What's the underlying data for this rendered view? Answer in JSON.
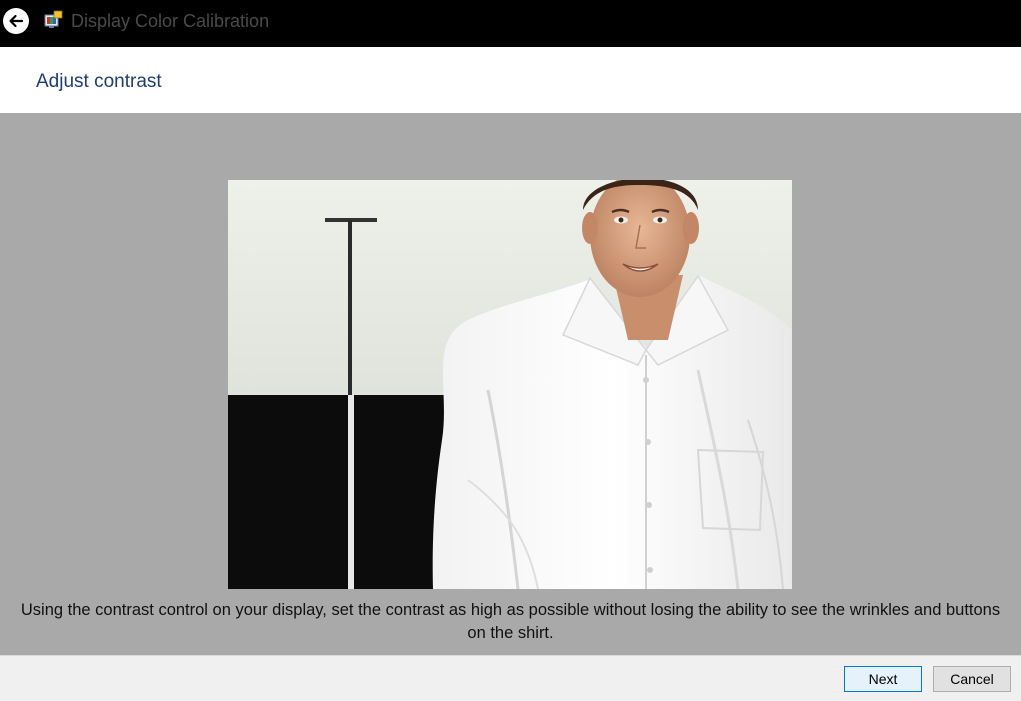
{
  "titlebar": {
    "back_icon": "back-arrow-icon",
    "app_icon": "display-color-calibration-icon",
    "title": "Display Color Calibration"
  },
  "header": {
    "title": "Adjust contrast"
  },
  "content": {
    "image": "calibration-photo-man-in-white-shirt",
    "instructions": "Using the contrast control on your display, set the contrast as high as possible without losing the ability to see the wrinkles and buttons on the shirt."
  },
  "footer": {
    "next_label": "Next",
    "cancel_label": "Cancel"
  },
  "colors": {
    "titlebar_bg": "#000000",
    "header_title": "#1e3c78",
    "content_bg": "#a9a9a9",
    "footer_bg": "#f0f0f0",
    "next_border": "#0078d7"
  }
}
